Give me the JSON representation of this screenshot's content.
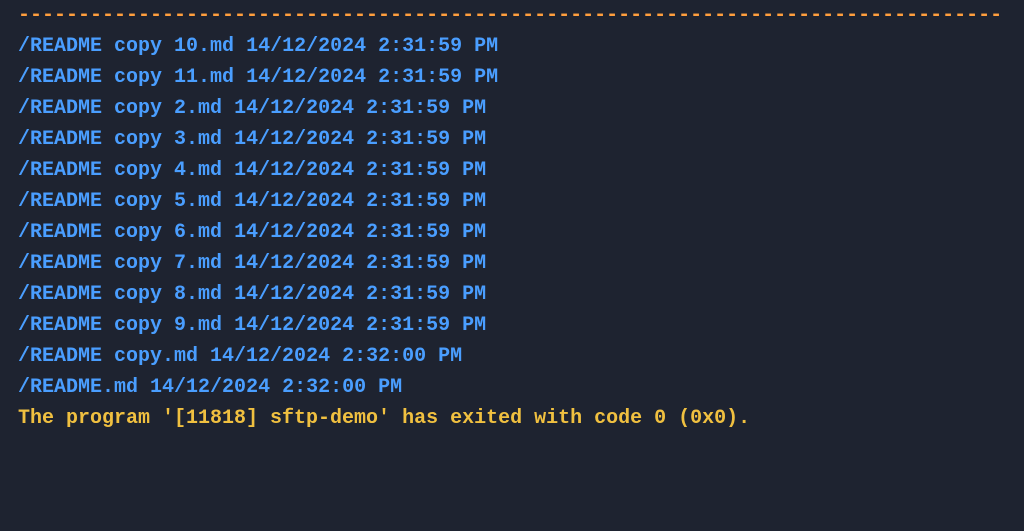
{
  "separator": "----------------------------------------------------------------------------------",
  "files": [
    {
      "path": "/README copy 10.md",
      "date": "14/12/2024",
      "time": "2:31:59 PM"
    },
    {
      "path": "/README copy 11.md",
      "date": "14/12/2024",
      "time": "2:31:59 PM"
    },
    {
      "path": "/README copy 2.md",
      "date": "14/12/2024",
      "time": "2:31:59 PM"
    },
    {
      "path": "/README copy 3.md",
      "date": "14/12/2024",
      "time": "2:31:59 PM"
    },
    {
      "path": "/README copy 4.md",
      "date": "14/12/2024",
      "time": "2:31:59 PM"
    },
    {
      "path": "/README copy 5.md",
      "date": "14/12/2024",
      "time": "2:31:59 PM"
    },
    {
      "path": "/README copy 6.md",
      "date": "14/12/2024",
      "time": "2:31:59 PM"
    },
    {
      "path": "/README copy 7.md",
      "date": "14/12/2024",
      "time": "2:31:59 PM"
    },
    {
      "path": "/README copy 8.md",
      "date": "14/12/2024",
      "time": "2:31:59 PM"
    },
    {
      "path": "/README copy 9.md",
      "date": "14/12/2024",
      "time": "2:31:59 PM"
    },
    {
      "path": "/README copy.md",
      "date": "14/12/2024",
      "time": "2:32:00 PM"
    },
    {
      "path": "/README.md",
      "date": "14/12/2024",
      "time": "2:32:00 PM"
    }
  ],
  "exit_message": "The program '[11818] sftp-demo' has exited with code 0 (0x0)."
}
